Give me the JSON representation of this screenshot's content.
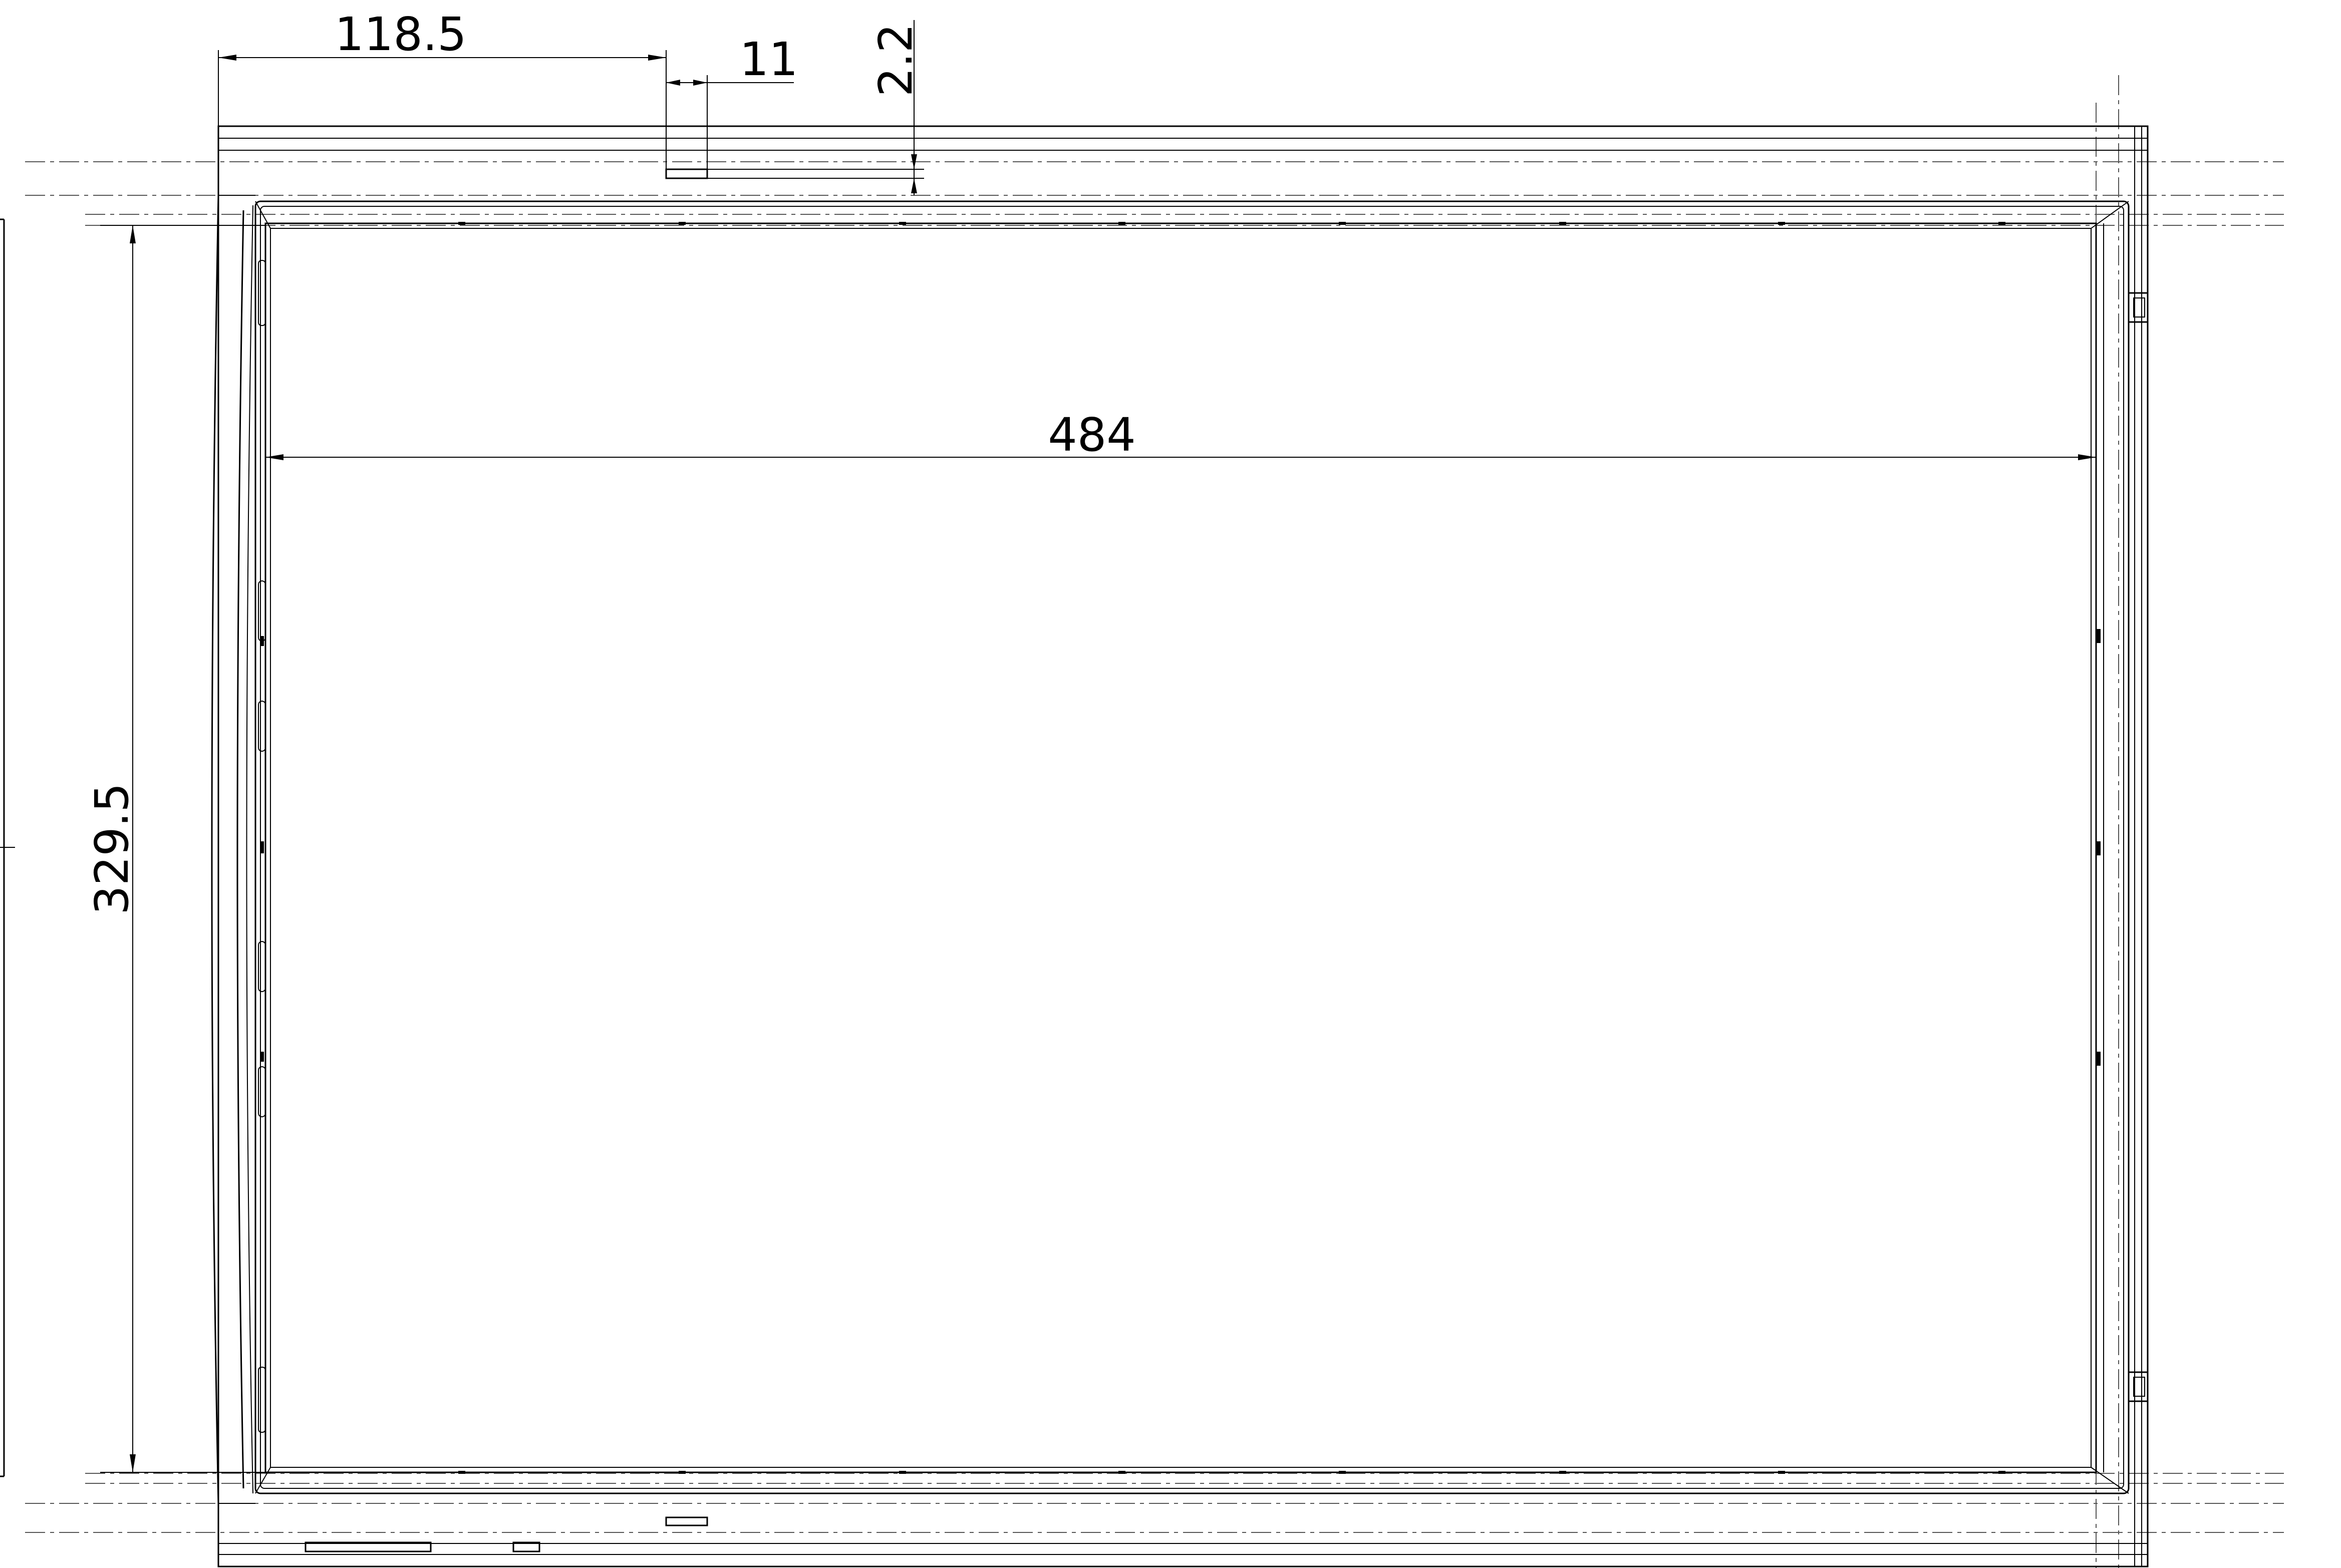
{
  "drawing": {
    "dimensions": {
      "offset_left": "118.5",
      "tab_width": "11",
      "tab_depth": "2.2",
      "inner_width": "484",
      "inner_height": "329.5"
    }
  }
}
